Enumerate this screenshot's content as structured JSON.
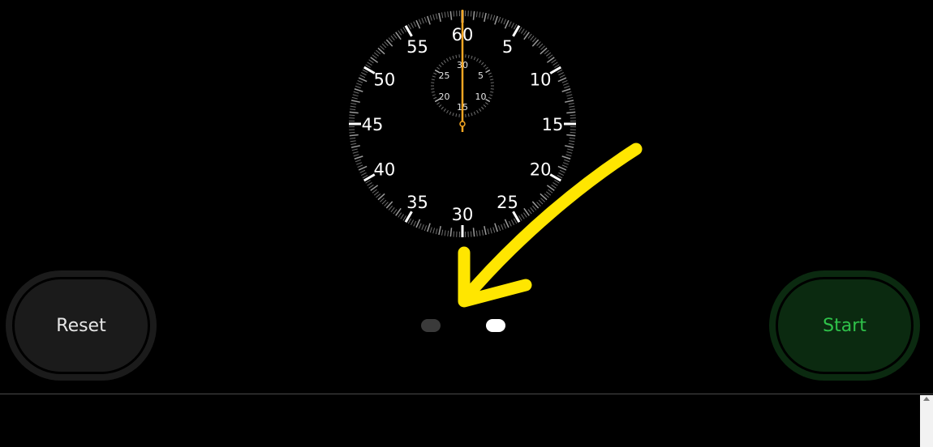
{
  "stopwatch": {
    "dial_numbers": [
      "60",
      "5",
      "10",
      "15",
      "20",
      "25",
      "30",
      "35",
      "40",
      "45",
      "50",
      "55"
    ],
    "sub_dial_numbers": [
      "30",
      "5",
      "10",
      "15",
      "20",
      "25"
    ],
    "hand_color": "#f5a623",
    "tick_color": "#8c8c8c",
    "number_color": "#ffffff",
    "elapsed_seconds": 0
  },
  "controls": {
    "reset_label": "Reset",
    "start_label": "Start",
    "reset_color": "#1b1b1b",
    "start_color": "#0b2a10",
    "start_text_color": "#2fc24a"
  },
  "pager": {
    "page_count": 2,
    "active_page": 2
  },
  "annotation": {
    "arrow_color": "#ffe600",
    "icon": "yellow-arrow-icon"
  }
}
